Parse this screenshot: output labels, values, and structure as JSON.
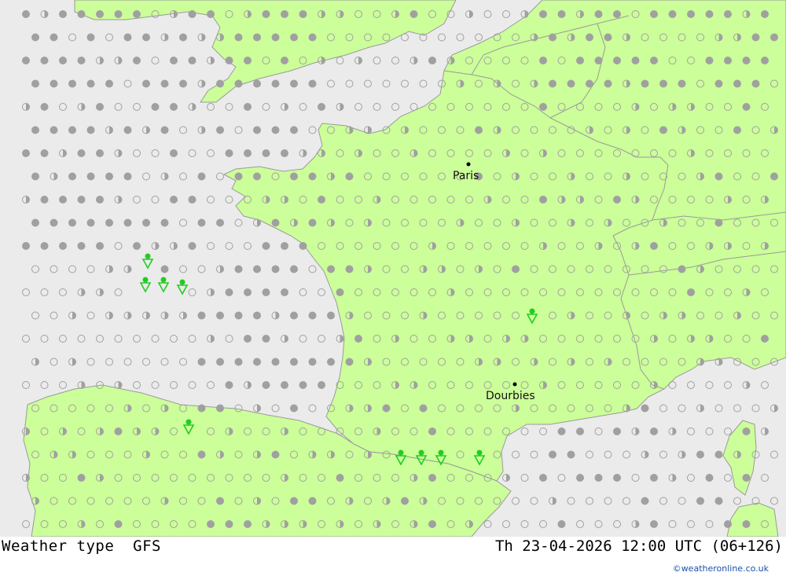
{
  "footer": {
    "title": "Weather type  GFS",
    "datetime": "Th 23-04-2026 12:00 UTC (06+126)",
    "credit": "©weatheronline.co.uk"
  },
  "cities": [
    {
      "name": "Paris"
    },
    {
      "name": "Dourbies"
    }
  ],
  "colors": {
    "sea": "#ebebeb",
    "land": "#ccff99",
    "border": "#9a9a9a",
    "symbol_gray": "#a0a0a0",
    "symbol_green": "#22cc22"
  },
  "legend_icons": [
    "open-circle-icon",
    "half-circle-icon",
    "filled-circle-icon",
    "rain-shower-icon"
  ]
}
